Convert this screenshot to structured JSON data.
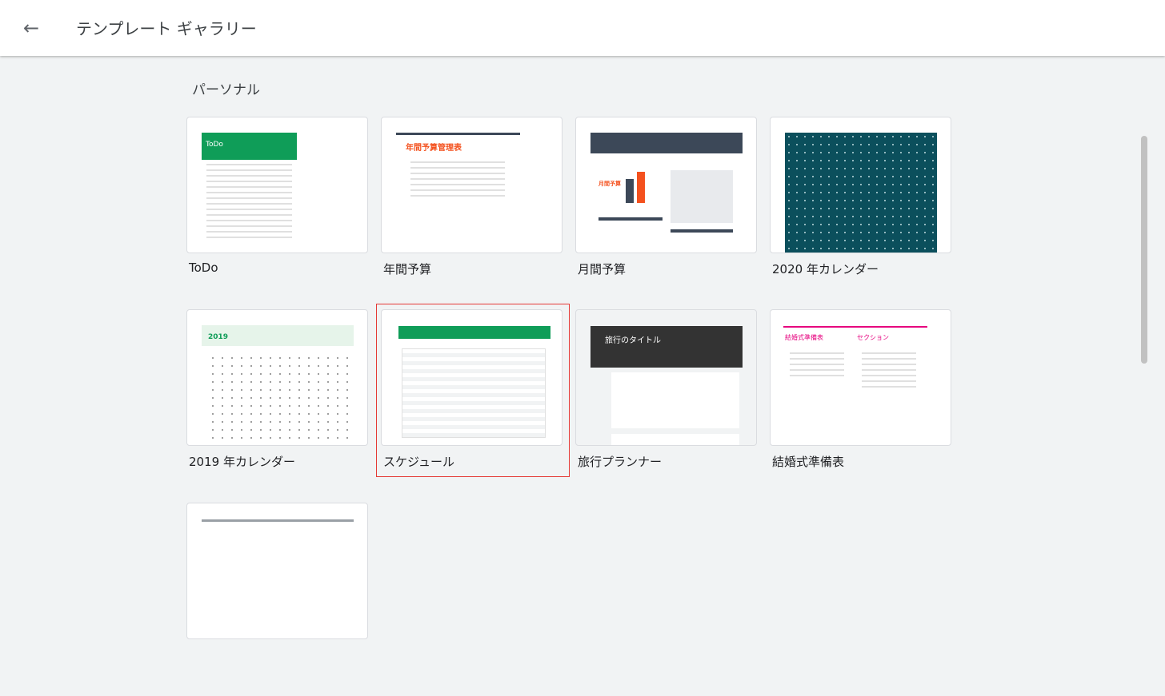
{
  "header": {
    "title": "テンプレート ギャラリー",
    "back_icon": "arrow-left-icon"
  },
  "section": {
    "title": "パーソナル"
  },
  "templates": [
    {
      "label": "ToDo",
      "thumb_text": "ToDo",
      "accent": "#0f9d58"
    },
    {
      "label": "年間予算",
      "thumb_text": "年間予算管理表",
      "accent": "#f4511e"
    },
    {
      "label": "月間予算",
      "thumb_text": "月間予算",
      "accent": "#f4511e"
    },
    {
      "label": "2020 年カレンダー",
      "accent": "#0b4f5c"
    },
    {
      "label": "2019 年カレンダー",
      "thumb_text": "2019",
      "accent": "#0f9d58"
    },
    {
      "label": "スケジュール",
      "accent": "#0f9d58",
      "selected": true
    },
    {
      "label": "旅行プランナー",
      "thumb_text": "旅行のタイトル",
      "accent": "#333333"
    },
    {
      "label": "結婚式準備表",
      "thumb_text": "結婚式準備表",
      "thumb_text2": "セクション",
      "accent": "#e6007e"
    }
  ],
  "colors": {
    "selection_border": "#e53935",
    "background": "#f1f3f4"
  }
}
